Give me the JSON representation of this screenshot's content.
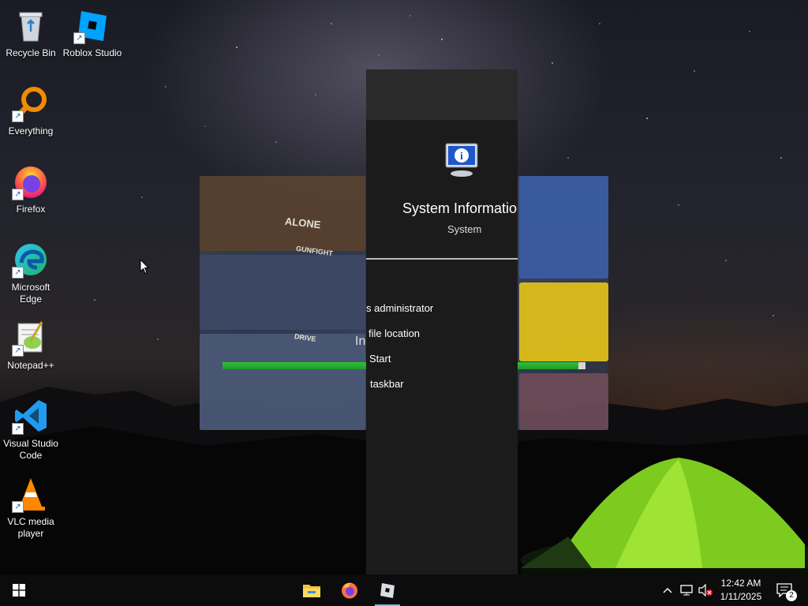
{
  "desktop": {
    "icons": [
      {
        "label": "Recycle Bin",
        "icon": "recycle-bin-icon"
      },
      {
        "label": "Roblox Studio",
        "icon": "roblox-studio-icon"
      },
      {
        "label": "Everything",
        "icon": "everything-search-icon"
      },
      {
        "label": "Firefox",
        "icon": "firefox-icon"
      },
      {
        "label": "Microsoft Edge",
        "icon": "edge-icon"
      },
      {
        "label": "Notepad++",
        "icon": "notepad-plus-plus-icon"
      },
      {
        "label": "Visual Studio Code",
        "icon": "vscode-icon"
      },
      {
        "label": "VLC media player",
        "icon": "vlc-icon"
      }
    ]
  },
  "splash": {
    "status_text": "In",
    "progress": 0.98,
    "tile_texts": [
      "ALONE",
      "GUNFIGHT",
      "DRIVE"
    ]
  },
  "panel": {
    "app_title": "System Informatio",
    "app_subtitle": "System",
    "items": [
      {
        "label": "s administrator"
      },
      {
        "label": "file location"
      },
      {
        "label": "Start"
      },
      {
        "label": "taskbar"
      }
    ]
  },
  "taskbar": {
    "pinned": [
      "file-explorer-icon",
      "firefox-icon",
      "roblox-studio-icon"
    ],
    "time": "12:42 AM",
    "date": "1/11/2025",
    "notification_count": "2"
  },
  "colors": {
    "accent": "#76b9ed",
    "progress_green": "#1ca62a",
    "taskbar_bg": "#0c0c0c"
  }
}
